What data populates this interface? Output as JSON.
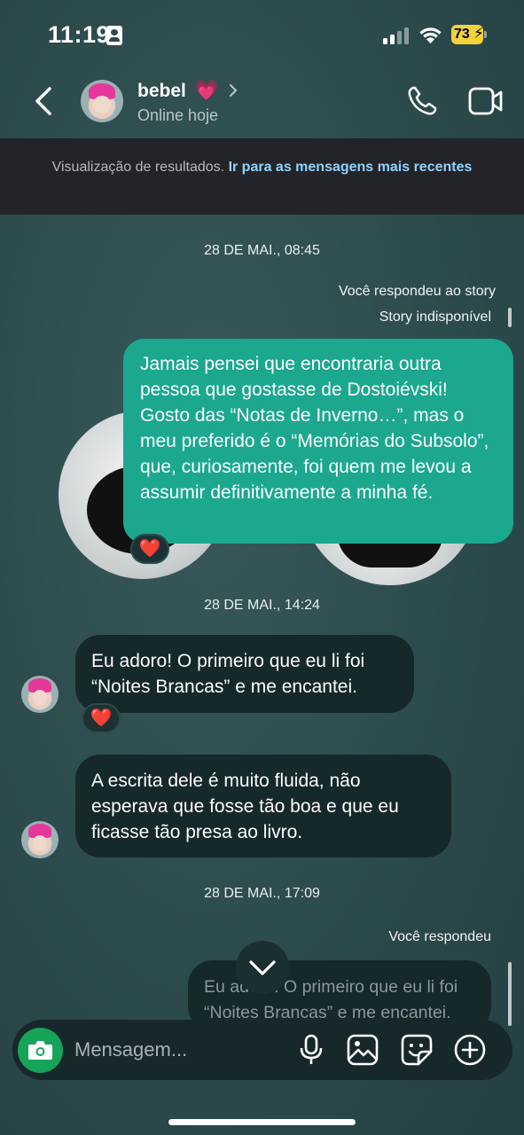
{
  "status_bar": {
    "time": "11:19",
    "battery": "73"
  },
  "header": {
    "contact_name": "bebel",
    "name_emoji": "💗",
    "contact_status": "Online hoje"
  },
  "banner": {
    "text": "Visualização de resultados.",
    "link": "Ir para as mensagens mais recentes"
  },
  "chat": {
    "date1": "28 DE MAI., 08:45",
    "reply_label1": "Você respondeu ao story",
    "story_unavailable": "Story indisponível",
    "msg1": "Jamais pensei que encontraria outra pessoa que gostasse de Dostoiévski! Gosto das “Notas de Inverno…”, mas o meu preferido é o “Memórias do Subsolo”, que, curiosamente, foi quem me levou a assumir definitivamente a minha fé.",
    "reaction": "❤️",
    "date2": "28 DE MAI., 14:24",
    "msg2": "Eu adoro! O primeiro que eu li foi “Noites Brancas” e me encantei.",
    "msg3": "A escrita dele é muito fluida, não esperava que fosse tão boa e que eu ficasse tão presa ao livro.",
    "date3": "28 DE MAI., 17:09",
    "reply_label2": "Você respondeu",
    "quoted": "Eu adoro! O primeiro que eu li foi “Noites Brancas” e me encantei."
  },
  "composer": {
    "placeholder": "Mensagem..."
  },
  "colors": {
    "sent": "#1ba88f",
    "received": "#15282a",
    "link": "#8fd3ff",
    "camera": "#18a35a"
  }
}
